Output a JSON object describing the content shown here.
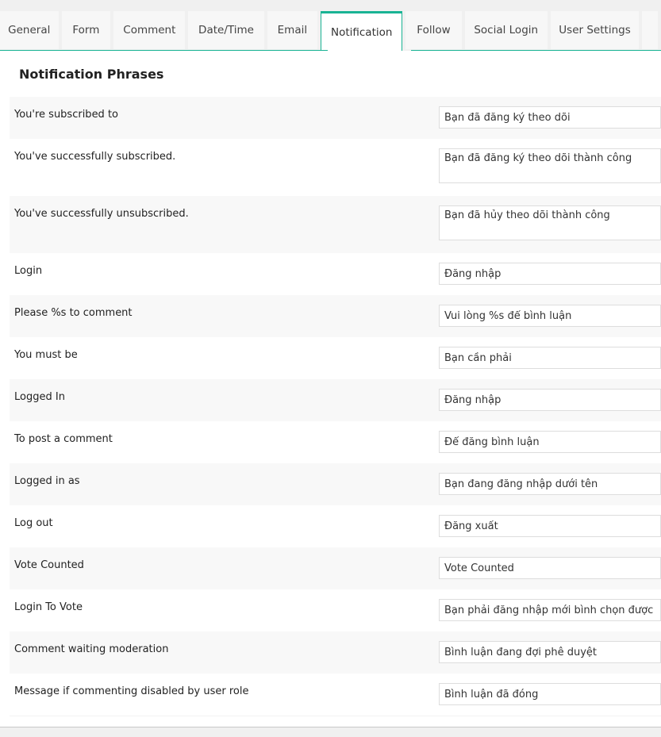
{
  "tabs": [
    {
      "label": "General",
      "active": false
    },
    {
      "label": "Form",
      "active": false
    },
    {
      "label": "Comment",
      "active": false
    },
    {
      "label": "Date/Time",
      "active": false
    },
    {
      "label": "Email",
      "active": false
    },
    {
      "label": "Notification",
      "active": true
    },
    {
      "label": "Follow",
      "active": false
    },
    {
      "label": "Social Login",
      "active": false
    },
    {
      "label": "User Settings",
      "active": false
    }
  ],
  "accent_color": "#19b394",
  "section": {
    "title": "Notification Phrases",
    "rows": [
      {
        "label": "You're subscribed to",
        "value": "Bạn đã đăng ký theo dõi",
        "type": "input"
      },
      {
        "label": "You've successfully subscribed.",
        "value": "Bạn đã đăng ký theo dõi thành công",
        "type": "textarea"
      },
      {
        "label": "You've successfully unsubscribed.",
        "value": "Bạn đã hủy theo dõi thành công",
        "type": "textarea"
      },
      {
        "label": "Login",
        "value": "Đăng nhập",
        "type": "input"
      },
      {
        "label": "Please %s to comment",
        "value": "Vui lòng %s để bình luận",
        "type": "input"
      },
      {
        "label": "You must be",
        "value": "Bạn cần phải",
        "type": "input"
      },
      {
        "label": "Logged In",
        "value": "Đăng nhập",
        "type": "input"
      },
      {
        "label": "To post a comment",
        "value": "Để đăng bình luận",
        "type": "input"
      },
      {
        "label": "Logged in as",
        "value": "Bạn đang đăng nhập dưới tên",
        "type": "input"
      },
      {
        "label": "Log out",
        "value": "Đăng xuất",
        "type": "input"
      },
      {
        "label": "Vote Counted",
        "value": "Vote Counted",
        "type": "input"
      },
      {
        "label": "Login To Vote",
        "value": "Bạn phải đăng nhập mới bình chọn được",
        "type": "input"
      },
      {
        "label": "Comment waiting moderation",
        "value": "Bình luận đang đợi phê duyệt",
        "type": "input"
      },
      {
        "label": "Message if commenting disabled by user role",
        "value": "Bình luận đã đóng",
        "type": "input"
      }
    ]
  }
}
